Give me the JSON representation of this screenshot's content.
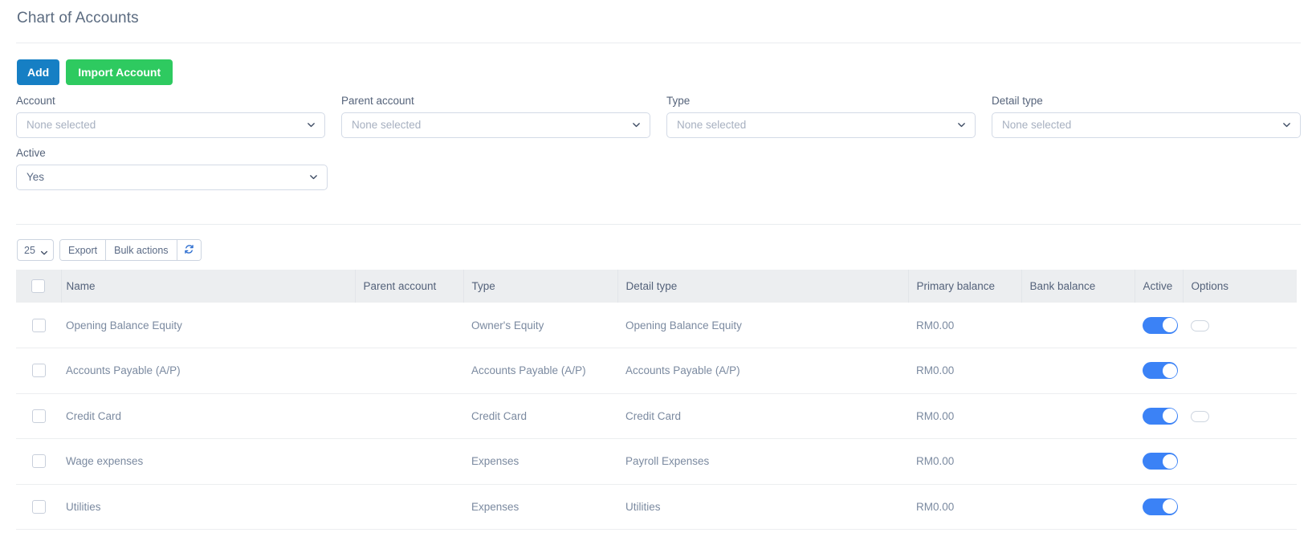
{
  "page": {
    "title": "Chart of Accounts"
  },
  "actions": {
    "add_label": "Add",
    "import_label": "Import Account"
  },
  "colors": {
    "add_button": "#167fc4",
    "import_button": "#2eca60",
    "toggle_on": "#3b82f6",
    "header_bg": "#eceef0",
    "text": "#5a6a85",
    "placeholder": "#a7b0c0"
  },
  "filters": [
    {
      "label": "Account",
      "value": "None selected",
      "filled": false
    },
    {
      "label": "Parent account",
      "value": "None selected",
      "filled": false
    },
    {
      "label": "Type",
      "value": "None selected",
      "filled": false
    },
    {
      "label": "Detail type",
      "value": "None selected",
      "filled": false
    },
    {
      "label": "Active",
      "value": "Yes",
      "filled": true
    }
  ],
  "toolbar": {
    "page_size": "25",
    "page_size_options": [
      "25"
    ],
    "export_label": "Export",
    "bulk_actions_label": "Bulk actions",
    "refresh_icon": "refresh-icon"
  },
  "table": {
    "columns": [
      "",
      "Name",
      "Parent account",
      "Type",
      "Detail type",
      "Primary balance",
      "Bank balance",
      "Active",
      "Options"
    ],
    "rows": [
      {
        "name": "Opening Balance Equity",
        "parent_account": "",
        "type": "Owner's Equity",
        "detail_type": "Opening Balance Equity",
        "primary_balance": "RM0.00",
        "bank_balance": "",
        "active": true,
        "has_option": true
      },
      {
        "name": "Accounts Payable (A/P)",
        "parent_account": "",
        "type": "Accounts Payable (A/P)",
        "detail_type": "Accounts Payable (A/P)",
        "primary_balance": "RM0.00",
        "bank_balance": "",
        "active": true,
        "has_option": false
      },
      {
        "name": "Credit Card",
        "parent_account": "",
        "type": "Credit Card",
        "detail_type": "Credit Card",
        "primary_balance": "RM0.00",
        "bank_balance": "",
        "active": true,
        "has_option": true
      },
      {
        "name": "Wage expenses",
        "parent_account": "",
        "type": "Expenses",
        "detail_type": "Payroll Expenses",
        "primary_balance": "RM0.00",
        "bank_balance": "",
        "active": true,
        "has_option": false
      },
      {
        "name": "Utilities",
        "parent_account": "",
        "type": "Expenses",
        "detail_type": "Utilities",
        "primary_balance": "RM0.00",
        "bank_balance": "",
        "active": true,
        "has_option": false
      }
    ]
  }
}
